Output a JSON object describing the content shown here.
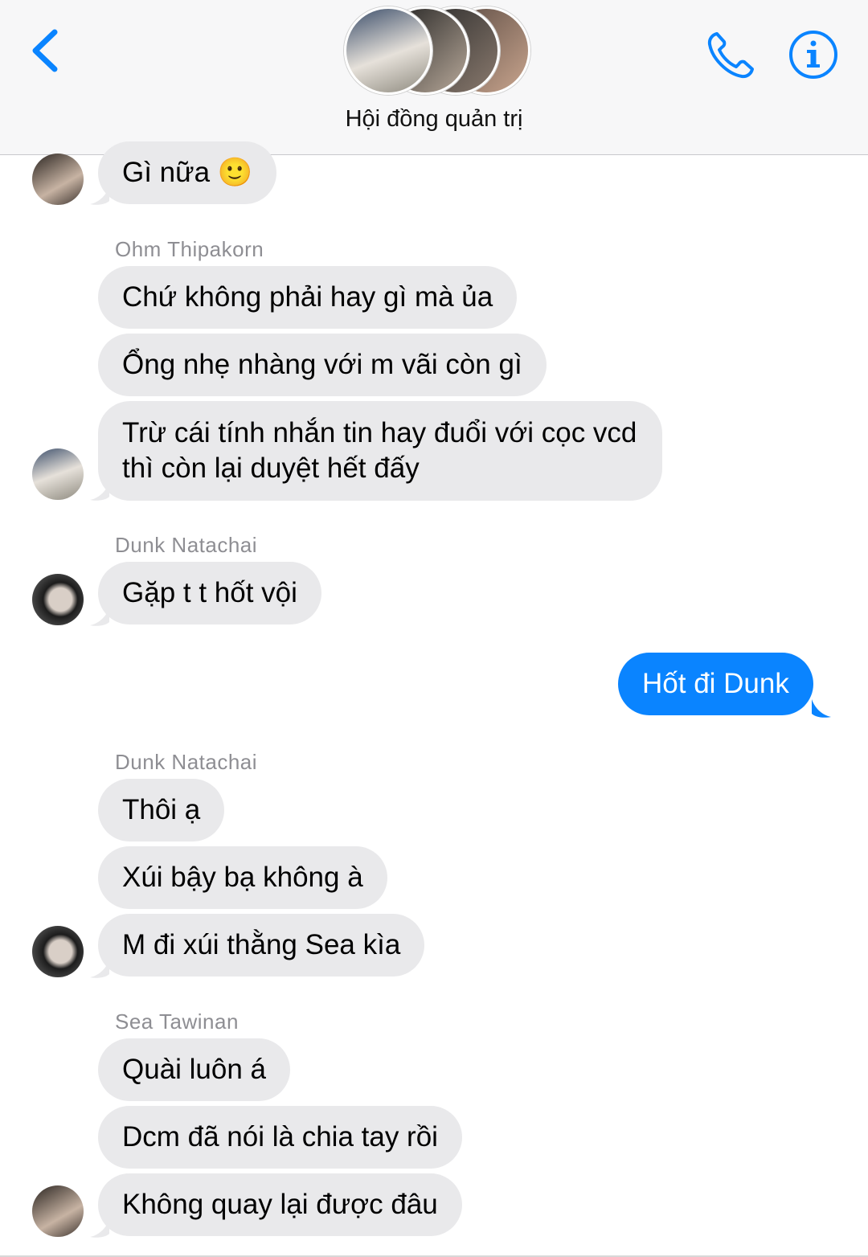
{
  "header": {
    "title": "Hội đồng quản trị",
    "back_icon": "chevron-left-icon",
    "call_icon": "phone-icon",
    "info_icon": "info-icon",
    "accent": "#0a84ff"
  },
  "messages": {
    "m0": "Gì nữa 🙂",
    "s1": "Ohm Thipakorn",
    "m1": "Chứ không phải hay gì mà ủa",
    "m2": "Ổng nhẹ nhàng với m vãi còn gì",
    "m3": "Trừ cái tính nhắn tin hay đuổi với cọc vcd thì còn lại duyệt hết đấy",
    "s2": "Dunk Natachai",
    "m4": "Gặp t t hốt vội",
    "m5": "Hốt đi Dunk",
    "s3": "Dunk Natachai",
    "m6": "Thôi ạ",
    "m7": "Xúi bậy bạ không à",
    "m8": "M đi xúi thằng Sea kìa",
    "s4": "Sea Tawinan",
    "m9": "Quài luôn á",
    "m10": "Dcm đã nói là chia tay rồi",
    "m11": "Không quay lại được đâu"
  },
  "colors": {
    "incoming_bubble": "#e9e9eb",
    "outgoing_bubble": "#0a84ff",
    "sender_name": "#8e8e93"
  }
}
